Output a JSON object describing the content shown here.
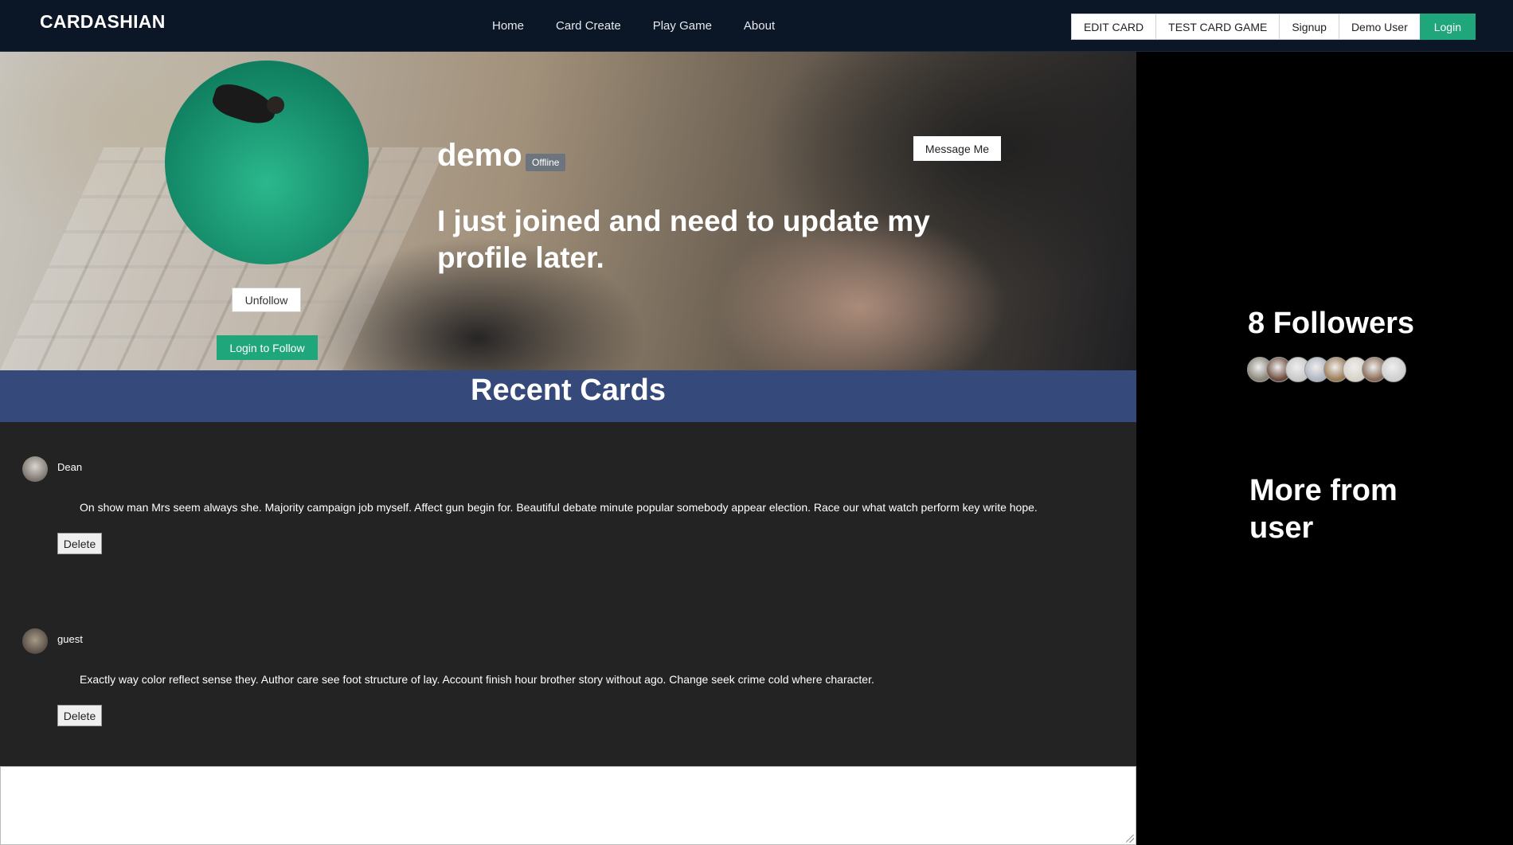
{
  "navbar": {
    "brand": "CARDASHIAN",
    "links": [
      "Home",
      "Card Create",
      "Play Game",
      "About"
    ],
    "buttons": {
      "edit_card": "EDIT CARD",
      "test_card_game": "TEST CARD GAME",
      "signup": "Signup",
      "demo_user": "Demo User",
      "login": "Login"
    },
    "login_color": "#1fa67a"
  },
  "profile": {
    "username": "demo",
    "status": "Offline",
    "bio": "I just joined and need to update my profile later.",
    "message_button": "Message Me",
    "unfollow_button": "Unfollow",
    "login_follow_button": "Login to Follow"
  },
  "recent": {
    "title": "Recent Cards",
    "cards": [
      {
        "author": "Dean",
        "text": "On show man Mrs seem always she. Majority campaign job myself. Affect gun begin for. Beautiful debate minute popular somebody appear election. Race our what watch perform key write hope.",
        "delete_label": "Delete"
      },
      {
        "author": "guest",
        "text": "Exactly way color reflect sense they. Author care see foot structure of lay. Account finish hour brother story without ago. Change seek crime cold where character.",
        "delete_label": "Delete"
      }
    ]
  },
  "sidebar": {
    "followers_title": "8 Followers",
    "follower_colors": [
      "#8a8578",
      "#6b4a3a",
      "#c8c8c8",
      "#aeb4c0",
      "#9c7a52",
      "#d8d2c8",
      "#8a6a55",
      "#cfcfcf"
    ],
    "more_title": "More from user"
  },
  "colors": {
    "navbar_bg": "#0b1626",
    "recent_header_bg": "#35497a",
    "cards_bg": "#232323",
    "accent": "#1fa67a"
  }
}
